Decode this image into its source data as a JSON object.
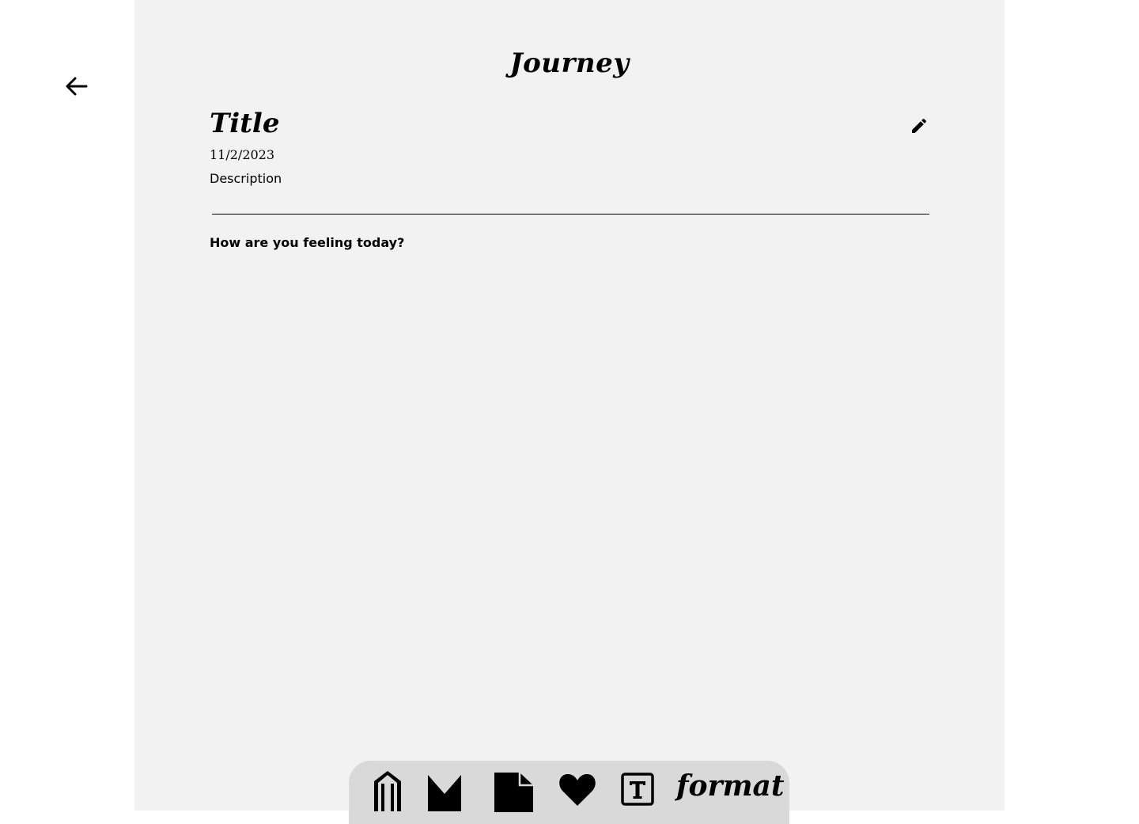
{
  "header": {
    "app_title": "Journey",
    "back_icon": "arrow-left-icon"
  },
  "entry": {
    "title": "Title",
    "date": "11/2/2023",
    "description": "Description",
    "edit_icon": "pencil-icon"
  },
  "prompt": {
    "text": "How are you feeling today?"
  },
  "toolbar": {
    "items": [
      {
        "icon": "pen-icon"
      },
      {
        "icon": "bookmark-icon"
      },
      {
        "icon": "document-icon"
      },
      {
        "icon": "heart-icon"
      },
      {
        "icon": "text-box-icon"
      }
    ],
    "format_label": "format"
  },
  "colors": {
    "page_background": "#ffffff",
    "panel_background": "#f2f2f2",
    "toolbar_background": "#d9d9d9",
    "foreground": "#000000"
  }
}
